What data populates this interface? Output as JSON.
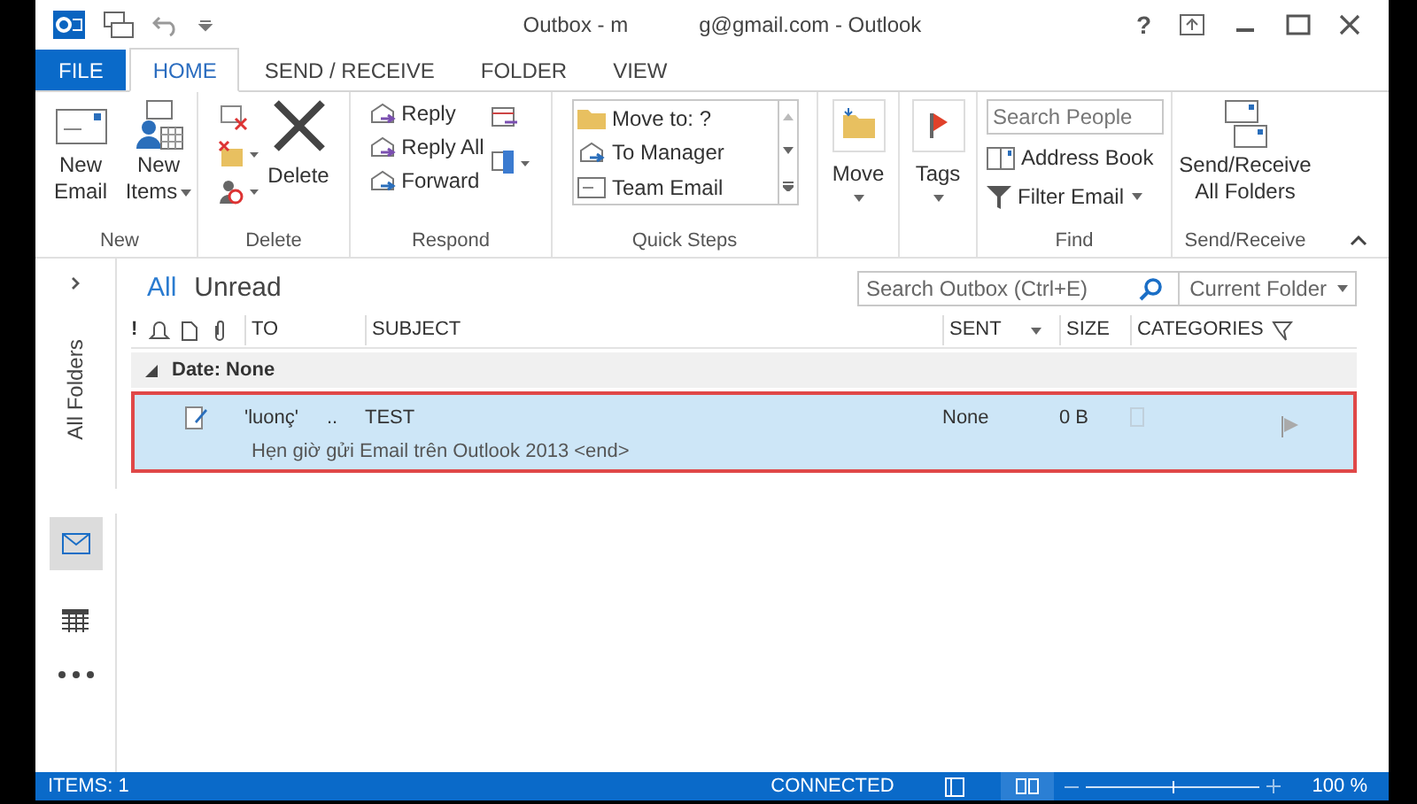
{
  "window": {
    "title_parts": [
      "Outbox - m",
      "g@gmail.com - Outlook"
    ],
    "help": "?"
  },
  "tabs": [
    {
      "label": "FILE",
      "kind": "file",
      "selected": false
    },
    {
      "label": "HOME",
      "kind": "tab",
      "selected": true
    },
    {
      "label": "SEND / RECEIVE",
      "kind": "tab",
      "selected": false
    },
    {
      "label": "FOLDER",
      "kind": "tab",
      "selected": false
    },
    {
      "label": "VIEW",
      "kind": "tab",
      "selected": false
    }
  ],
  "ribbon": {
    "new": {
      "label": "New",
      "buttons": [
        "New Email",
        "New Items"
      ]
    },
    "delete": {
      "label": "Delete",
      "button": "Delete"
    },
    "respond": {
      "label": "Respond",
      "buttons": [
        "Reply",
        "Reply All",
        "Forward"
      ]
    },
    "quick_steps": {
      "label": "Quick Steps",
      "items": [
        "Move to: ?",
        "To Manager",
        "Team Email"
      ]
    },
    "move": {
      "label": "Move"
    },
    "tags": {
      "label": "Tags"
    },
    "find": {
      "label": "Find",
      "placeholder": "Search People",
      "buttons": [
        "Address Book",
        "Filter Email"
      ]
    },
    "send_receive": {
      "label": "Send/Receive",
      "button": "Send/Receive All Folders"
    }
  },
  "nav": {
    "label": "All Folders"
  },
  "filters": [
    {
      "label": "All",
      "selected": true
    },
    {
      "label": "Unread",
      "selected": false
    }
  ],
  "search": {
    "placeholder": "Search Outbox (Ctrl+E)",
    "scope": "Current Folder"
  },
  "columns": {
    "importance": "!",
    "to": "TO",
    "subject": "SUBJECT",
    "sent": "SENT",
    "size": "SIZE",
    "categories": "CATEGORIES"
  },
  "group": {
    "label": "Date: None",
    "expanded": true
  },
  "rows": [
    {
      "to": "'luonç'",
      "to_tail": "..",
      "subject": "TEST",
      "preview": "Hẹn giờ gửi Email trên Outlook 2013 <end>",
      "sent": "None",
      "size": "0 B",
      "selected": true
    }
  ],
  "status": {
    "items": "ITEMS: 1",
    "connection": "CONNECTED",
    "zoom": "100 %",
    "level": 0.5
  }
}
